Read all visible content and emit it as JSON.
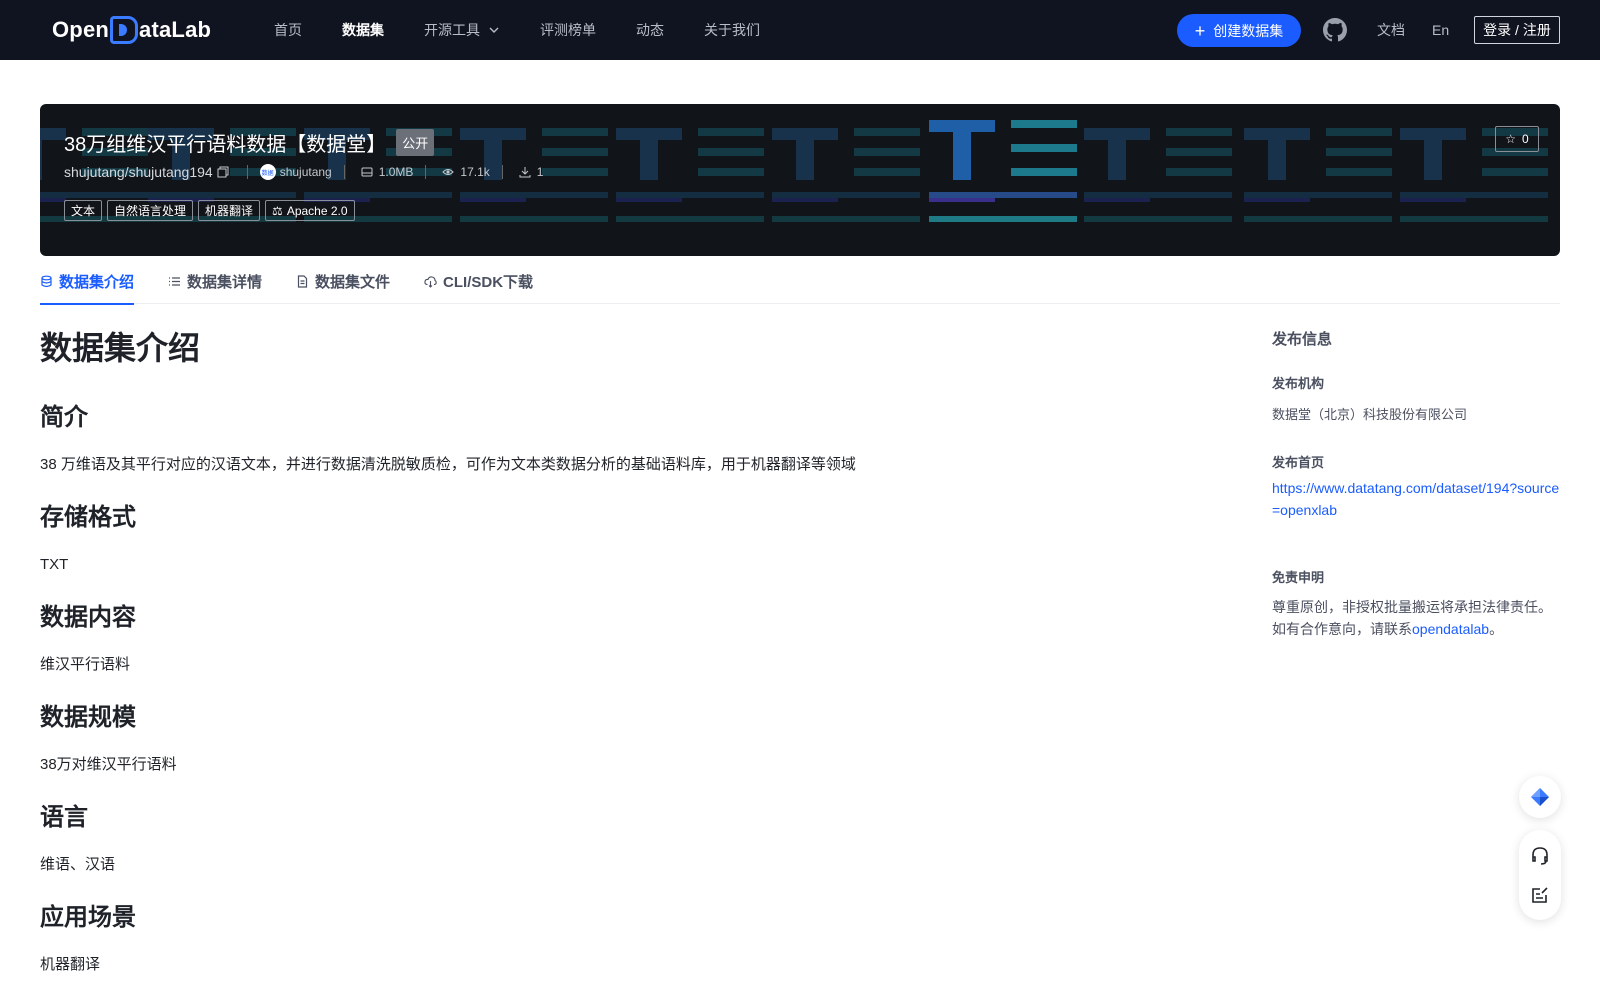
{
  "nav": {
    "logo_text_1": "Open",
    "logo_text_2": "ataLab",
    "items": [
      {
        "label": "首页",
        "active": false
      },
      {
        "label": "数据集",
        "active": true
      },
      {
        "label": "开源工具",
        "active": false,
        "dropdown": true
      },
      {
        "label": "评测榜单",
        "active": false
      },
      {
        "label": "动态",
        "active": false
      },
      {
        "label": "关于我们",
        "active": false
      }
    ],
    "create_label": "创建数据集",
    "docs_label": "文档",
    "lang_label": "En",
    "login_label": "登录 / 注册",
    "github_icon": "github-icon"
  },
  "banner": {
    "title": "38万组维汉平行语料数据【数据堂】",
    "visibility": "公开",
    "repo": "shujutang/shujutang194",
    "owner": "shujutang",
    "avatar_text": "数据",
    "size": "1.0MB",
    "views": "17.1k",
    "downloads": "1",
    "tags": [
      "文本",
      "自然语言处理",
      "机器翻译"
    ],
    "license": "Apache 2.0",
    "stars": "0"
  },
  "tabs": [
    {
      "label": "数据集介绍",
      "icon": "database-icon",
      "active": true
    },
    {
      "label": "数据集详情",
      "icon": "list-icon",
      "active": false
    },
    {
      "label": "数据集文件",
      "icon": "file-icon",
      "active": false
    },
    {
      "label": "CLI/SDK下载",
      "icon": "cloud-download-icon",
      "active": false
    }
  ],
  "content": {
    "heading": "数据集介绍",
    "sections": [
      {
        "title": "简介",
        "body": "38 万维语及其平行对应的汉语文本，并进行数据清洗脱敏质检，可作为文本类数据分析的基础语料库，用于机器翻译等领域"
      },
      {
        "title": "存储格式",
        "body": "TXT"
      },
      {
        "title": "数据内容",
        "body": "维汉平行语料"
      },
      {
        "title": "数据规模",
        "body": "38万对维汉平行语料"
      },
      {
        "title": "语言",
        "body": "维语、汉语"
      },
      {
        "title": "应用场景",
        "body": "机器翻译"
      }
    ]
  },
  "sidebar": {
    "title": "发布信息",
    "org_label": "发布机构",
    "org_value": "数据堂（北京）科技股份有限公司",
    "home_label": "发布首页",
    "home_url": "https://www.datatang.com/dataset/194?source=openxlab",
    "disclaimer_label": "免责申明",
    "disclaimer_text": "尊重原创，非授权批量搬运将承担法律责任。如有合作意向，请联系",
    "disclaimer_link": "opendatalab",
    "disclaimer_end": "。"
  },
  "colors": {
    "nav_bg": "#101320",
    "accent": "#1a5cff",
    "banner_bg": "#111418"
  }
}
